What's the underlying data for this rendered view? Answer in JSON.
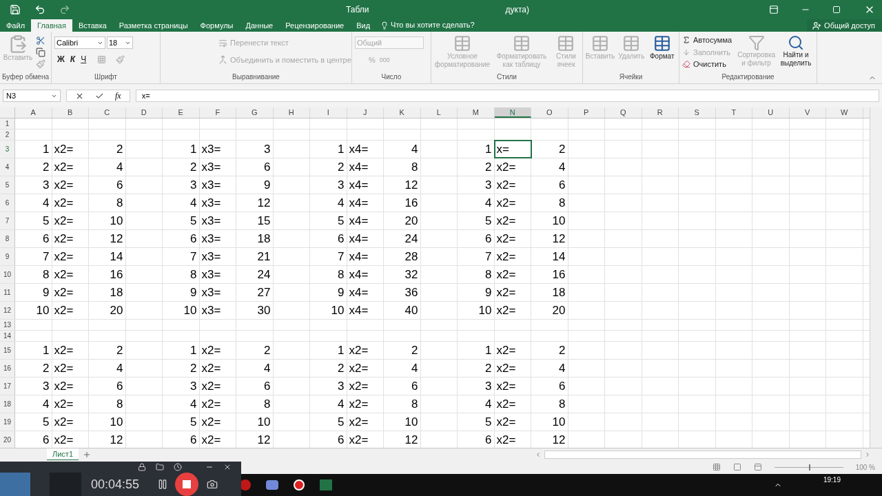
{
  "window": {
    "title_start": "Табли",
    "title_end": "дукта)"
  },
  "tabs": [
    {
      "label": "Файл",
      "selected": false
    },
    {
      "label": "Главная",
      "selected": true
    },
    {
      "label": "Вставка",
      "selected": false
    },
    {
      "label": "Разметка страницы",
      "selected": false
    },
    {
      "label": "Формулы",
      "selected": false
    },
    {
      "label": "Данные",
      "selected": false
    },
    {
      "label": "Рецензирование",
      "selected": false
    },
    {
      "label": "Вид",
      "selected": false
    }
  ],
  "tell_me": "Что вы хотите сделать?",
  "share": "Общий доступ",
  "ribbon": {
    "clipboard": {
      "label": "Буфер обмена",
      "paste": {
        "label": "Вставить",
        "disabled": true
      }
    },
    "font": {
      "label": "Шрифт",
      "family": "Calibri",
      "size": "18",
      "bold": "Ж",
      "italic": "К",
      "underline": "Ч"
    },
    "alignment": {
      "label": "Выравнивание",
      "wrap": {
        "label": "Перенести текст",
        "disabled": true
      },
      "merge": {
        "label": "Объединить и поместить в центре",
        "disabled": true
      }
    },
    "number": {
      "label": "Число",
      "format": "Общий",
      "percent": "%",
      "thousands": "000"
    },
    "styles": {
      "label": "Стили",
      "items": [
        {
          "label": "Условное форматирование",
          "disabled": true
        },
        {
          "label": "Форматировать как таблицу",
          "disabled": true
        },
        {
          "label": "Стили ячеек",
          "disabled": true
        }
      ]
    },
    "cells": {
      "label": "Ячейки",
      "items": [
        {
          "label": "Вставить",
          "disabled": true
        },
        {
          "label": "Удалить",
          "disabled": true
        },
        {
          "label": "Формат",
          "disabled": false
        }
      ]
    },
    "editing": {
      "label": "Редактирование",
      "items": [
        {
          "label": "Автосумма",
          "disabled": false
        },
        {
          "label": "Заполнить",
          "disabled": true
        },
        {
          "label": "Очистить",
          "disabled": false
        }
      ],
      "sort": {
        "label": "Сортировка и фильтр",
        "disabled": true
      },
      "find": {
        "label": "Найти и выделить",
        "disabled": false
      }
    }
  },
  "name_box": "N3",
  "formula": "x=",
  "function_label": "fx",
  "columns": [
    {
      "label": "A",
      "selected": false
    },
    {
      "label": "B",
      "selected": false
    },
    {
      "label": "C",
      "selected": false
    },
    {
      "label": "D",
      "selected": false
    },
    {
      "label": "E",
      "selected": false
    },
    {
      "label": "F",
      "selected": false
    },
    {
      "label": "G",
      "selected": false
    },
    {
      "label": "H",
      "selected": false
    },
    {
      "label": "I",
      "selected": false
    },
    {
      "label": "J",
      "selected": false
    },
    {
      "label": "K",
      "selected": false
    },
    {
      "label": "L",
      "selected": false
    },
    {
      "label": "M",
      "selected": false
    },
    {
      "label": "N",
      "selected": true
    },
    {
      "label": "O",
      "selected": false
    },
    {
      "label": "P",
      "selected": false
    },
    {
      "label": "Q",
      "selected": false
    },
    {
      "label": "R",
      "selected": false
    },
    {
      "label": "S",
      "selected": false
    },
    {
      "label": "T",
      "selected": false
    },
    {
      "label": "U",
      "selected": false
    },
    {
      "label": "V",
      "selected": false
    },
    {
      "label": "W",
      "selected": false
    }
  ],
  "rows": [
    {
      "number": "1",
      "selected": false,
      "cells": []
    },
    {
      "number": "2",
      "selected": false,
      "cells": []
    },
    {
      "number": "3",
      "selected": true,
      "cells": [
        [
          "1",
          "x2=",
          "2"
        ],
        [
          "1",
          "x3=",
          "3"
        ],
        [
          "1",
          "x4=",
          "4"
        ],
        [
          "1",
          "x=",
          "2"
        ]
      ]
    },
    {
      "number": "4",
      "selected": false,
      "cells": [
        [
          "2",
          "x2=",
          "4"
        ],
        [
          "2",
          "x3=",
          "6"
        ],
        [
          "2",
          "x4=",
          "8"
        ],
        [
          "2",
          "x2=",
          "4"
        ]
      ]
    },
    {
      "number": "5",
      "selected": false,
      "cells": [
        [
          "3",
          "x2=",
          "6"
        ],
        [
          "3",
          "x3=",
          "9"
        ],
        [
          "3",
          "x4=",
          "12"
        ],
        [
          "3",
          "x2=",
          "6"
        ]
      ]
    },
    {
      "number": "6",
      "selected": false,
      "cells": [
        [
          "4",
          "x2=",
          "8"
        ],
        [
          "4",
          "x3=",
          "12"
        ],
        [
          "4",
          "x4=",
          "16"
        ],
        [
          "4",
          "x2=",
          "8"
        ]
      ]
    },
    {
      "number": "7",
      "selected": false,
      "cells": [
        [
          "5",
          "x2=",
          "10"
        ],
        [
          "5",
          "x3=",
          "15"
        ],
        [
          "5",
          "x4=",
          "20"
        ],
        [
          "5",
          "x2=",
          "10"
        ]
      ]
    },
    {
      "number": "8",
      "selected": false,
      "cells": [
        [
          "6",
          "x2=",
          "12"
        ],
        [
          "6",
          "x3=",
          "18"
        ],
        [
          "6",
          "x4=",
          "24"
        ],
        [
          "6",
          "x2=",
          "12"
        ]
      ]
    },
    {
      "number": "9",
      "selected": false,
      "cells": [
        [
          "7",
          "x2=",
          "14"
        ],
        [
          "7",
          "x3=",
          "21"
        ],
        [
          "7",
          "x4=",
          "28"
        ],
        [
          "7",
          "x2=",
          "14"
        ]
      ]
    },
    {
      "number": "10",
      "selected": false,
      "cells": [
        [
          "8",
          "x2=",
          "16"
        ],
        [
          "8",
          "x3=",
          "24"
        ],
        [
          "8",
          "x4=",
          "32"
        ],
        [
          "8",
          "x2=",
          "16"
        ]
      ]
    },
    {
      "number": "11",
      "selected": false,
      "cells": [
        [
          "9",
          "x2=",
          "18"
        ],
        [
          "9",
          "x3=",
          "27"
        ],
        [
          "9",
          "x4=",
          "36"
        ],
        [
          "9",
          "x2=",
          "18"
        ]
      ]
    },
    {
      "number": "12",
      "selected": false,
      "cells": [
        [
          "10",
          "x2=",
          "20"
        ],
        [
          "10",
          "x3=",
          "30"
        ],
        [
          "10",
          "x4=",
          "40"
        ],
        [
          "10",
          "x2=",
          "20"
        ]
      ]
    },
    {
      "number": "13",
      "selected": false,
      "cells": []
    },
    {
      "number": "14",
      "selected": false,
      "cells": []
    },
    {
      "number": "15",
      "selected": false,
      "cells": [
        [
          "1",
          "x2=",
          "2"
        ],
        [
          "1",
          "x2=",
          "2"
        ],
        [
          "1",
          "x2=",
          "2"
        ],
        [
          "1",
          "x2=",
          "2"
        ]
      ]
    },
    {
      "number": "16",
      "selected": false,
      "cells": [
        [
          "2",
          "x2=",
          "4"
        ],
        [
          "2",
          "x2=",
          "4"
        ],
        [
          "2",
          "x2=",
          "4"
        ],
        [
          "2",
          "x2=",
          "4"
        ]
      ]
    },
    {
      "number": "17",
      "selected": false,
      "cells": [
        [
          "3",
          "x2=",
          "6"
        ],
        [
          "3",
          "x2=",
          "6"
        ],
        [
          "3",
          "x2=",
          "6"
        ],
        [
          "3",
          "x2=",
          "6"
        ]
      ]
    },
    {
      "number": "18",
      "selected": false,
      "cells": [
        [
          "4",
          "x2=",
          "8"
        ],
        [
          "4",
          "x2=",
          "8"
        ],
        [
          "4",
          "x2=",
          "8"
        ],
        [
          "4",
          "x2=",
          "8"
        ]
      ]
    },
    {
      "number": "19",
      "selected": false,
      "cells": [
        [
          "5",
          "x2=",
          "10"
        ],
        [
          "5",
          "x2=",
          "10"
        ],
        [
          "5",
          "x2=",
          "10"
        ],
        [
          "5",
          "x2=",
          "10"
        ]
      ]
    },
    {
      "number": "20",
      "selected": false,
      "cells": [
        [
          "6",
          "x2=",
          "12"
        ],
        [
          "6",
          "x2=",
          "12"
        ],
        [
          "6",
          "x2=",
          "12"
        ],
        [
          "6",
          "x2=",
          "12"
        ]
      ]
    }
  ],
  "sheets": [
    {
      "label": "Лист1",
      "selected": true
    }
  ],
  "status": {
    "zoom": "100 %",
    "level": 0.5
  },
  "recorder": {
    "time": "00:04:55"
  },
  "taskbar": {
    "time": "19:19"
  }
}
